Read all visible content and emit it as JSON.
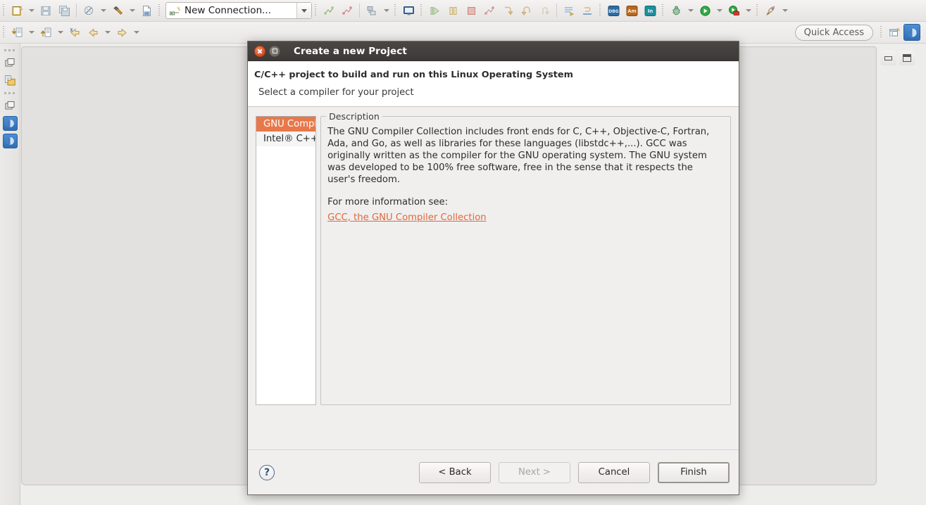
{
  "window": {
    "quick_access_label": "Quick Access"
  },
  "toolbar_row1": {
    "items": [
      {
        "name": "new-wizard-button",
        "icon": "new-file-icon"
      },
      {
        "name": "new-wizard-dropdown",
        "icon": "chevron-down-icon"
      },
      {
        "name": "save-button",
        "icon": "save-icon"
      },
      {
        "name": "save-all-button",
        "icon": "save-all-icon"
      },
      {
        "name": "build-all-button",
        "icon": "build-disabled-icon"
      },
      {
        "name": "build-all-dropdown",
        "icon": "chevron-down-icon"
      },
      {
        "name": "build-button",
        "icon": "hammer-icon"
      },
      {
        "name": "build-dropdown",
        "icon": "chevron-down-icon"
      },
      {
        "name": "binary-file-button",
        "icon": "binary-file-icon"
      }
    ],
    "connection": {
      "label": "New Connection...",
      "icon": "connection-icon"
    },
    "right_items": [
      {
        "name": "skip-breakpoints-button",
        "icon": "breakpoint-green-icon"
      },
      {
        "name": "breakpoint-button",
        "icon": "breakpoint-red-icon"
      },
      {
        "name": "registers-button",
        "icon": "registers-icon"
      },
      {
        "name": "registers-dropdown",
        "icon": "chevron-down-icon"
      },
      {
        "name": "console-button",
        "icon": "console-icon"
      },
      {
        "name": "resume-button",
        "icon": "resume-icon"
      },
      {
        "name": "suspend-button",
        "icon": "suspend-icon"
      },
      {
        "name": "terminate-button",
        "icon": "terminate-icon"
      },
      {
        "name": "disconnect-button",
        "icon": "disconnect-icon"
      },
      {
        "name": "step-into-button",
        "icon": "step-into-icon"
      },
      {
        "name": "step-over-button",
        "icon": "step-over-icon"
      },
      {
        "name": "step-return-button",
        "icon": "step-return-icon"
      },
      {
        "name": "instruction-stepping-button",
        "icon": "instruction-step-icon"
      },
      {
        "name": "drop-to-frame-button",
        "icon": "drop-to-frame-icon"
      },
      {
        "name": "dbg-badge-button",
        "icon": "dbg-badge-icon",
        "badge": "DBG"
      },
      {
        "name": "amplifier-badge-button",
        "icon": "amplifier-badge-icon",
        "badge": "Am"
      },
      {
        "name": "inspector-badge-button",
        "icon": "inspector-badge-icon",
        "badge": "In"
      },
      {
        "name": "debug-button",
        "icon": "bug-icon"
      },
      {
        "name": "debug-dropdown",
        "icon": "chevron-down-icon"
      },
      {
        "name": "run-button",
        "icon": "run-green-icon"
      },
      {
        "name": "run-dropdown",
        "icon": "chevron-down-icon"
      },
      {
        "name": "profile-button",
        "icon": "run-toolbox-icon"
      },
      {
        "name": "profile-dropdown",
        "icon": "chevron-down-icon"
      },
      {
        "name": "launch-button",
        "icon": "rocket-icon"
      },
      {
        "name": "launch-dropdown",
        "icon": "chevron-down-icon"
      }
    ]
  },
  "toolbar_row2": {
    "items": [
      {
        "name": "import-button",
        "icon": "import-down-icon"
      },
      {
        "name": "import-dropdown",
        "icon": "chevron-down-icon"
      },
      {
        "name": "export-button",
        "icon": "export-up-icon"
      },
      {
        "name": "export-dropdown",
        "icon": "chevron-down-icon"
      },
      {
        "name": "back-history-button",
        "icon": "back-arrow-star-icon"
      },
      {
        "name": "back-button",
        "icon": "back-arrow-icon"
      },
      {
        "name": "back-dropdown",
        "icon": "chevron-down-icon"
      },
      {
        "name": "forward-button",
        "icon": "forward-arrow-icon"
      },
      {
        "name": "forward-dropdown",
        "icon": "chevron-down-icon"
      }
    ]
  },
  "sidebar": {
    "items": [
      {
        "name": "restore-view-button",
        "icon": "restore-icon"
      },
      {
        "name": "project-explorer-button",
        "icon": "project-explorer-icon"
      },
      {
        "name": "restore-view-button-2",
        "icon": "restore-icon"
      },
      {
        "name": "perspective-button-1",
        "icon": "perspective-icon"
      },
      {
        "name": "perspective-button-2",
        "icon": "perspective-icon"
      }
    ]
  },
  "window_controls": {
    "minimize_label": "minimize",
    "maximize_label": "maximize"
  },
  "dialog": {
    "title": "Create a new Project",
    "header_title": "C/C++ project to build and run on this Linux Operating System",
    "header_subtitle": "Select a compiler for your project",
    "compilers": [
      {
        "label": "GNU Compiler Collection (GCC)",
        "selected": true
      },
      {
        "label": "Intel® C++ Compiler (ICC)",
        "selected": false
      }
    ],
    "description": {
      "legend": "Description",
      "body": "The GNU Compiler Collection includes front ends for C, C++, Objective-C, Fortran, Ada, and Go, as well as libraries for these languages (libstdc++,...). GCC was originally written as the compiler for the GNU operating system. The GNU system was developed to be 100% free software, free in the sense that it respects the user's freedom.",
      "more_info_label": "For more information see:",
      "link_label": "GCC, the GNU Compiler Collection"
    },
    "buttons": {
      "help": "?",
      "back": "< Back",
      "next": "Next >",
      "cancel": "Cancel",
      "finish": "Finish"
    }
  },
  "colors": {
    "selection_orange": "#e8784a",
    "link_orange": "#e2673a",
    "dialog_bg": "#f0efee",
    "titlebar_dark": "#443f3c",
    "accent_blue": "#2f6cb4"
  }
}
